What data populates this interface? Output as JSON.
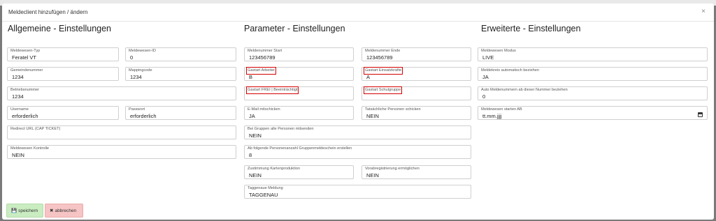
{
  "dialog": {
    "title": "Meldeclient hinzufügen / ändern",
    "close": "×"
  },
  "sections": {
    "general": "Allgemeine - Einstellungen",
    "params": "Parameter - Einstellungen",
    "extended": "Erweiterte - Einstellungen"
  },
  "general": {
    "meldewesen_typ": {
      "label": "Meldewesen-Typ",
      "value": "Feratel VT"
    },
    "meldewesen_id": {
      "label": "Meldewesen-ID",
      "value": "0"
    },
    "gemeindenummer": {
      "label": "Gemeindenummer",
      "value": "1234"
    },
    "mappingcode": {
      "label": "Mappingcode",
      "value": "1234"
    },
    "betriebsnummer": {
      "label": "Betriebsnummer",
      "value": "1234"
    },
    "username": {
      "label": "Username",
      "value": "erforderlich"
    },
    "passwort": {
      "label": "Passwort",
      "value": "erforderlich"
    },
    "redirect_url": {
      "label": "Redirect URL (CAP TICKET)",
      "value": ""
    },
    "kontrolle": {
      "label": "Meldewesen Kontrolle",
      "value": "NEIN"
    }
  },
  "params": {
    "start": {
      "label": "Meldenummer Start",
      "value": "123456789"
    },
    "ende": {
      "label": "Meldenummer Ende",
      "value": "123456789"
    },
    "arbeiter": {
      "label": "Gastart Arbeiter",
      "value": "B"
    },
    "einsatzkraefte": {
      "label": "Gastart Einsatzkräfte",
      "value": "A"
    },
    "frei": {
      "label": "Gastart FREI | Beeinträchtigt",
      "value": ""
    },
    "schulgruppe": {
      "label": "Gastart Schulgruppe",
      "value": ""
    },
    "email": {
      "label": "E-Mail mitschicken",
      "value": "JA"
    },
    "tatsaechliche": {
      "label": "Tatsächliche Personen schicken",
      "value": "NEIN"
    },
    "gruppen_alle": {
      "label": "Bei Gruppen alle Personen mitsenden",
      "value": "NEIN"
    },
    "ab_anzahl": {
      "label": "Ab folgende Personenanzahl Gruppenmeldeschein erstellen",
      "value": "8"
    },
    "zustimmung": {
      "label": "Zustimmung Kartenproduktion",
      "value": "NEIN"
    },
    "vorab": {
      "label": "Vorabregistrierung ermöglichen",
      "value": "NEIN"
    },
    "taggenaue": {
      "label": "Taggenaue Meldung",
      "value": "TAGGENAU"
    }
  },
  "extended": {
    "modus": {
      "label": "Meldewesen Modus",
      "value": "LIVE"
    },
    "meldekreis": {
      "label": "Meldekreis automatisch beziehen",
      "value": "JA"
    },
    "auto_nummer": {
      "label": "Auto Meldenummern ab dieser Nummer beziehen",
      "value": "0"
    },
    "starten_ab": {
      "label": "Meldewesen starten AB",
      "value": "tt.mm.jjjj"
    }
  },
  "buttons": {
    "save": "speichern",
    "cancel": "abbrechen",
    "save_icon": "floppy-icon",
    "cancel_icon": "x-icon"
  },
  "colors": {
    "highlight": "#d40000",
    "save_bg": "#c9ecc1",
    "cancel_bg": "#f6c4c4"
  }
}
